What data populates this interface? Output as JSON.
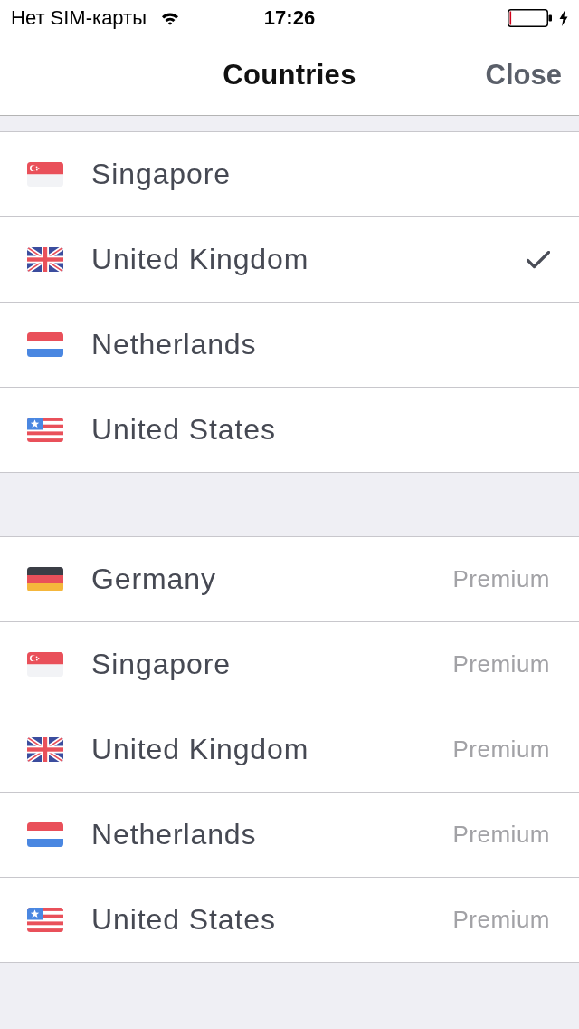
{
  "status_bar": {
    "carrier": "Нет SIM-карты",
    "time": "17:26"
  },
  "nav_bar": {
    "title": "Countries",
    "close": "Close"
  },
  "sections": [
    {
      "rows": [
        {
          "kind": "singapore",
          "country": "Singapore",
          "selected": false
        },
        {
          "kind": "britain",
          "country": "United Kingdom",
          "selected": true
        },
        {
          "kind": "netherlands",
          "country": "Netherlands",
          "selected": false
        },
        {
          "kind": "usa",
          "country": "United States",
          "selected": false
        }
      ]
    },
    {
      "rows": [
        {
          "kind": "germany",
          "country": "Germany",
          "tag": "Premium",
          "selected": false
        },
        {
          "kind": "singapore",
          "country": "Singapore",
          "tag": "Premium",
          "selected": false
        },
        {
          "kind": "britain",
          "country": "United Kingdom",
          "tag": "Premium",
          "selected": false
        },
        {
          "kind": "netherlands",
          "country": "Netherlands",
          "tag": "Premium",
          "selected": false
        },
        {
          "kind": "usa",
          "country": "United States",
          "tag": "Premium",
          "selected": false
        }
      ]
    }
  ]
}
